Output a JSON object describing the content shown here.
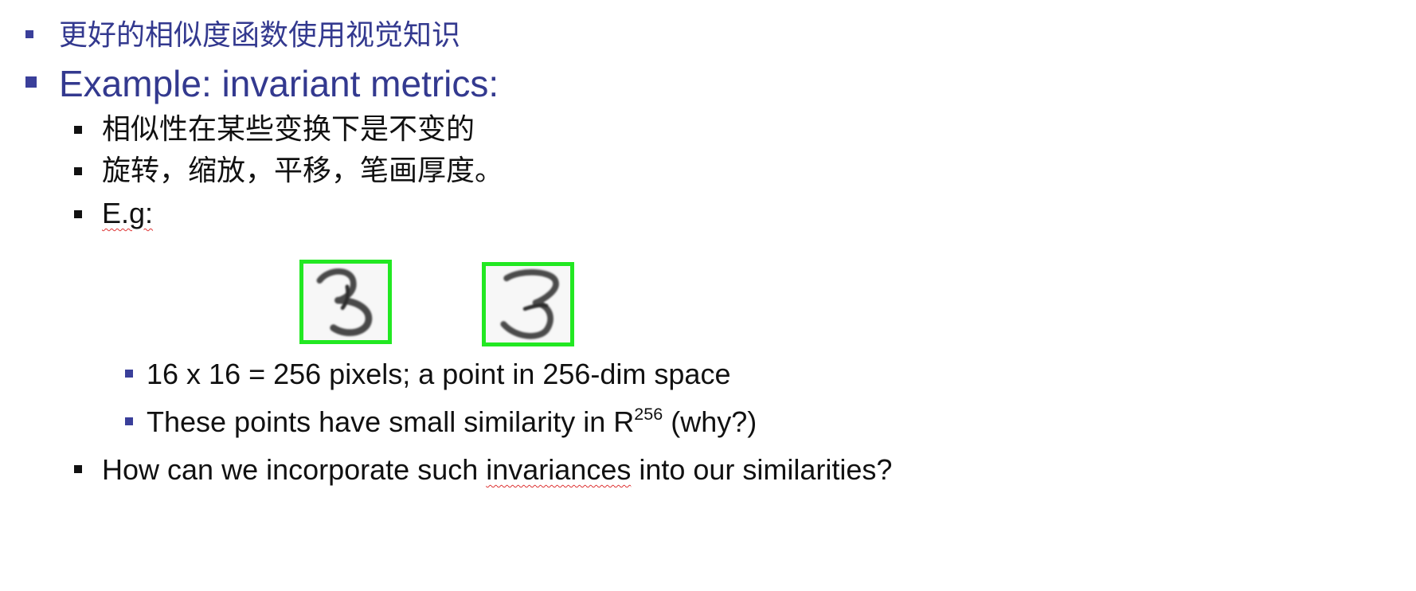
{
  "slide": {
    "bullets": [
      {
        "text": "更好的相似度函数使用视觉知识"
      },
      {
        "text": "Example: invariant metrics:"
      },
      {
        "text": "相似性在某些变换下是不变的"
      },
      {
        "text": "旋转，缩放，平移，笔画厚度。"
      },
      {
        "text": "E.g:"
      },
      {
        "text": "16 x 16 = 256 pixels; a point in 256-dim space"
      },
      {
        "text_before": "These points have small similarity in R",
        "sup": "256",
        "text_after": " (why?)"
      },
      {
        "text_before": "How can we incorporate such ",
        "squiggle": "invariances",
        "text_after": " into our similarities?"
      }
    ],
    "images": [
      {
        "name": "digit-three-image-1",
        "glyph": "3"
      },
      {
        "name": "digit-three-image-2",
        "glyph": "3"
      }
    ],
    "colors": {
      "heading_blue": "#33398f",
      "bullet_blue": "#3a3f9a",
      "text_black": "#111111",
      "image_border_green": "#22e822"
    }
  }
}
